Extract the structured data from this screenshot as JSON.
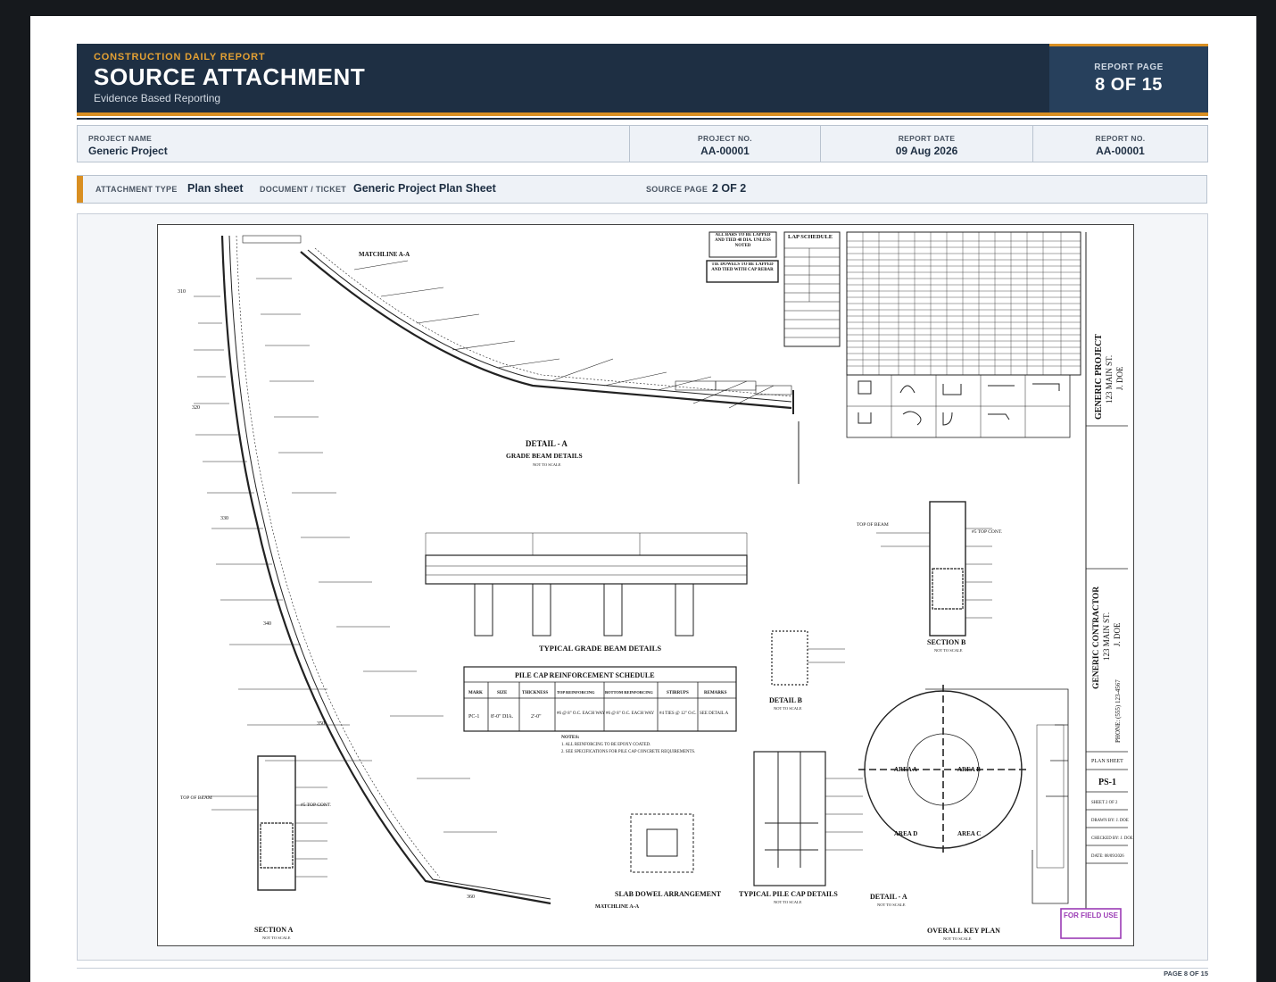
{
  "header": {
    "kicker": "CONSTRUCTION DAILY REPORT",
    "title": "SOURCE ATTACHMENT",
    "subtitle": "Evidence Based Reporting",
    "report_page_label": "REPORT PAGE",
    "report_page_value": "8 OF 15"
  },
  "info": {
    "project_name_label": "PROJECT NAME",
    "project_name": "Generic Project",
    "project_no_label": "PROJECT NO.",
    "project_no": "AA-00001",
    "report_date_label": "REPORT DATE",
    "report_date": "09 Aug 2026",
    "report_no_label": "REPORT NO.",
    "report_no": "AA-00001"
  },
  "attachment": {
    "type_label": "ATTACHMENT TYPE",
    "type_value": "Plan sheet",
    "doc_label": "DOCUMENT / TICKET",
    "doc_value": "Generic Project Plan Sheet",
    "source_label": "SOURCE PAGE",
    "source_value": "2 OF 2"
  },
  "drawing": {
    "matchline_top": "MATCHLINE A-A",
    "matchline_bottom": "MATCHLINE A-A",
    "detail_a_title": "DETAIL - A",
    "detail_a_sub": "GRADE BEAM DETAILS",
    "not_to_scale": "NOT TO SCALE",
    "typical_grade_beam": "TYPICAL GRADE BEAM DETAILS",
    "pile_cap_schedule_title": "PILE CAP REINFORCEMENT SCHEDULE",
    "pile_cap_headers": [
      "MARK",
      "SIZE",
      "THICKNESS",
      "TOP REINFORCING",
      "BOTTOM REINFORCING",
      "STIRRUPS",
      "REMARKS"
    ],
    "pile_cap_row": [
      "PC-1",
      "8'-0\" DIA.",
      "2'-0\"",
      "#6 @ 8\" O.C. EACH WAY",
      "#6 @ 8\" O.C. EACH WAY",
      "#4 TIES @ 12\" O.C.",
      "SEE DETAIL A"
    ],
    "notes_title": "NOTES:",
    "notes": [
      "1. ALL REINFORCING TO BE EPOXY COATED.",
      "2. SEE SPECIFICATIONS FOR PILE CAP CONCRETE REQUIREMENTS."
    ],
    "lap_schedule_title": "LAP SCHEDULE",
    "lap_note_1": "ALL BARS TO BE LAPPED AND TIED 48 DIA. UNLESS NOTED",
    "lap_note_2": "TIE DOWELS TO BE LAPPED AND TIED WITH CAP REBAR",
    "section_b": "SECTION B",
    "section_a": "SECTION A",
    "detail_b": "DETAIL B",
    "detail_a2": "DETAIL - A",
    "slab_dowel": "SLAB DOWEL ARRANGEMENT",
    "typical_pile_cap": "TYPICAL PILE CAP DETAILS",
    "overall_key_plan": "OVERALL KEY PLAN",
    "top_of_beam": "TOP OF BEAM",
    "top_cont": "#5 TOP CONT.",
    "areas": [
      "AREA A",
      "AREA B",
      "AREA D",
      "AREA C"
    ],
    "stations": [
      "310",
      "320",
      "330",
      "340",
      "350",
      "360"
    ],
    "for_field_use": "FOR FIELD USE"
  },
  "title_block": {
    "owner": "GENERIC PROJECT",
    "owner_address": "123 MAIN ST.",
    "owner_contact": "J. DOE",
    "contractor": "GENERIC CONTRACTOR",
    "contractor_address": "123 MAIN ST.",
    "contractor_contact": "J. DOE",
    "phone": "PHONE: (555) 123-4567",
    "sheet_label": "PLAN SHEET",
    "sheet_no": "PS-1",
    "sheet_of": "SHEET 2 OF 2",
    "drawn_by": "DRAWN BY: J. DOE",
    "checked_by": "CHECKED BY: J. DOE",
    "date": "DATE: 08/09/2026"
  },
  "footer": {
    "page": "PAGE 8 OF 15"
  },
  "colors": {
    "navy": "#1e2f43",
    "gold": "#d98f22",
    "stamp": "#9b3bb5"
  }
}
